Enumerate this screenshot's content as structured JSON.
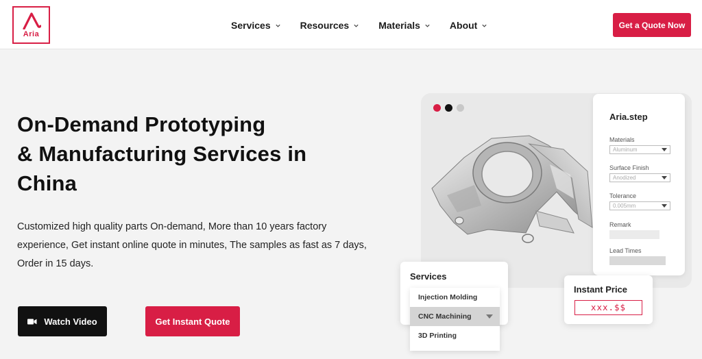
{
  "header": {
    "logo_text": "Aria",
    "nav": [
      {
        "label": "Services"
      },
      {
        "label": "Resources"
      },
      {
        "label": "Materials"
      },
      {
        "label": "About"
      }
    ],
    "cta_label": "Get a Quote Now"
  },
  "hero": {
    "title_lines": [
      "On-Demand Prototyping",
      "& Manufacturing Services in",
      "China"
    ],
    "description": "Customized high quality parts On-demand, More than 10 years factory experience, Get instant online quote in minutes, The samples as fast as 7 days, Order in 15 days.",
    "watch_video_label": "Watch Video",
    "instant_quote_label": "Get Instant Quote"
  },
  "illustration": {
    "dots": [
      "#d81e45",
      "#111111",
      "#c8c8c8"
    ],
    "panel": {
      "title": "Aria.step",
      "materials_label": "Materials",
      "materials_value": "Aluminum",
      "surface_label": "Surface Finish",
      "surface_value": "Anodized",
      "tolerance_label": "Tolerance",
      "tolerance_value": "0.005mm",
      "remark_label": "Remark",
      "lead_label": "Lead Times"
    },
    "services": {
      "title": "Services",
      "items": [
        "Injection Molding",
        "CNC Machining",
        "3D Printing"
      ],
      "selected": "CNC Machining"
    },
    "price": {
      "title": "Instant Price",
      "value": "xxx.$$"
    }
  },
  "colors": {
    "accent": "#d81e45",
    "dark": "#111111",
    "background": "#f3f3f3"
  }
}
